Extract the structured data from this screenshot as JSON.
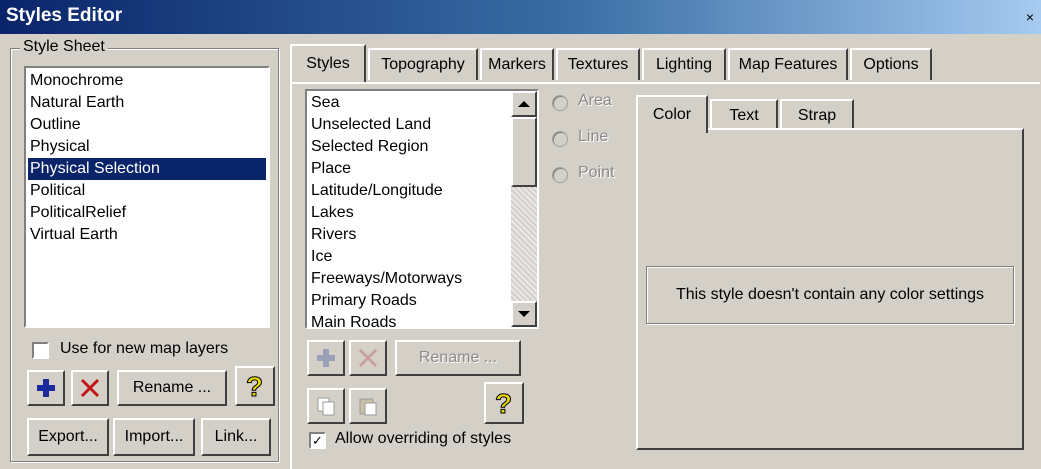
{
  "window": {
    "title": "Styles Editor",
    "close_glyph": "×"
  },
  "style_sheet": {
    "legend": "Style Sheet",
    "items": [
      "Monochrome",
      "Natural Earth",
      "Outline",
      "Physical",
      "Physical Selection",
      "Political",
      "PoliticalRelief",
      "Virtual Earth"
    ],
    "selected": "Physical Selection",
    "use_for_new_layers": "Use for new map layers",
    "use_for_new_layers_checked": false,
    "add_icon": "plus-icon",
    "delete_icon": "delete-x-icon",
    "rename": "Rename ...",
    "help_icon": "help-question-icon",
    "export": "Export...",
    "import": "Import...",
    "link": "Link..."
  },
  "tabs": [
    "Styles",
    "Topography",
    "Markers",
    "Textures",
    "Lighting",
    "Map Features",
    "Options"
  ],
  "active_tab": "Styles",
  "styles": {
    "items": [
      "Sea",
      "Unselected Land",
      "Selected Region",
      "Place",
      "Latitude/Longitude",
      "Lakes",
      "Rivers",
      "Ice",
      "Freeways/Motorways",
      "Primary Roads",
      "Main Roads"
    ],
    "radio_area": "Area",
    "radio_line": "Line",
    "radio_point": "Point",
    "rename": "Rename ...",
    "allow_overriding": "Allow overriding of styles",
    "allow_overriding_checked": true
  },
  "inner_tabs": [
    "Color",
    "Text",
    "Strap"
  ],
  "active_inner_tab": "Color",
  "color_message": "This style doesn't contain any color settings",
  "colors": {
    "selection": "#0a246a",
    "face": "#d4d0c8",
    "title_start": "#0a246a"
  }
}
